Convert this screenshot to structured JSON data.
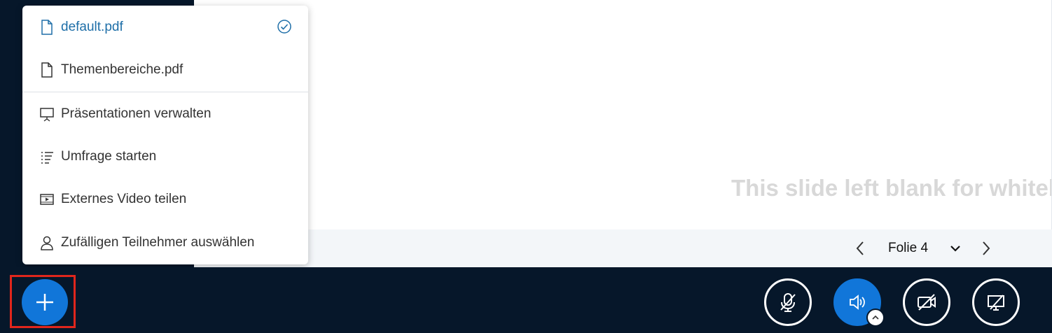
{
  "menu": {
    "items": [
      {
        "label": "default.pdf",
        "icon": "file-icon",
        "selected": true
      },
      {
        "label": "Themenbereiche.pdf",
        "icon": "file-icon",
        "selected": false
      },
      {
        "label": "Präsentationen verwalten",
        "icon": "presentation-icon"
      },
      {
        "label": "Umfrage starten",
        "icon": "poll-list-icon"
      },
      {
        "label": "Externes Video teilen",
        "icon": "video-icon"
      },
      {
        "label": "Zufälligen Teilnehmer auswählen",
        "icon": "user-icon"
      }
    ]
  },
  "slide": {
    "text": "This slide left blank for whiteboard",
    "current_label": "Folie 4"
  },
  "colors": {
    "background": "#06172a",
    "accent": "#1176d9",
    "highlight": "#e0261c",
    "active_item": "#1f6fa8"
  }
}
